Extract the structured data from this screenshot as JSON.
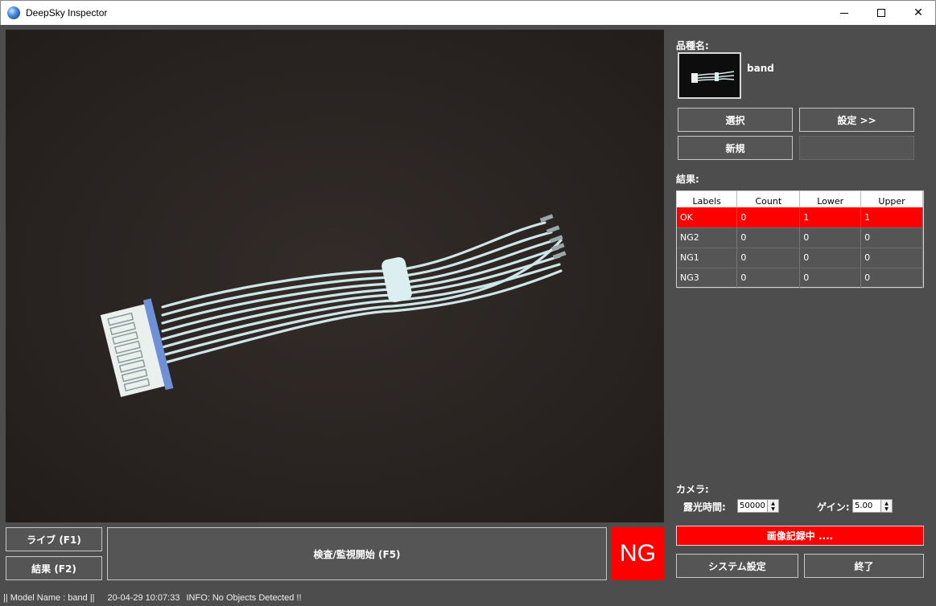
{
  "window": {
    "title": "DeepSky Inspector",
    "minimize_icon": "minimize-icon",
    "maximize_icon": "maximize-icon",
    "close_icon": "close-icon",
    "close_glyph": "✕"
  },
  "controls": {
    "live_label": "ライブ (F1)",
    "result_label": "結果 (F2)",
    "inspect_label": "検査/監視開始 (F5)",
    "judgement": "NG"
  },
  "model": {
    "section_label": "品種名:",
    "name": "band",
    "select_label": "選択",
    "settings_label": "設定 >>",
    "new_label": "新規"
  },
  "results": {
    "section_label": "結果:",
    "columns": [
      "Labels",
      "Count",
      "Lower",
      "Upper"
    ],
    "rows": [
      [
        "OK",
        "0",
        "1",
        "1"
      ],
      [
        "NG2",
        "0",
        "0",
        "0"
      ],
      [
        "NG1",
        "0",
        "0",
        "0"
      ],
      [
        "NG3",
        "0",
        "0",
        "0"
      ]
    ],
    "highlight_color": "#ff0000"
  },
  "camera": {
    "section_label": "カメラ:",
    "exposure_label": "露光時間:",
    "exposure_value": "50000",
    "gain_label": "ゲイン:",
    "gain_value": "5.00"
  },
  "recording_label": "画像記録中 ....",
  "system_settings_label": "システム設定",
  "exit_label": "終了",
  "status": {
    "model": "|| Model Name : band ||",
    "timestamp": "20-04-29 10:07:33",
    "info": "INFO:   No Objects Detected !!"
  }
}
